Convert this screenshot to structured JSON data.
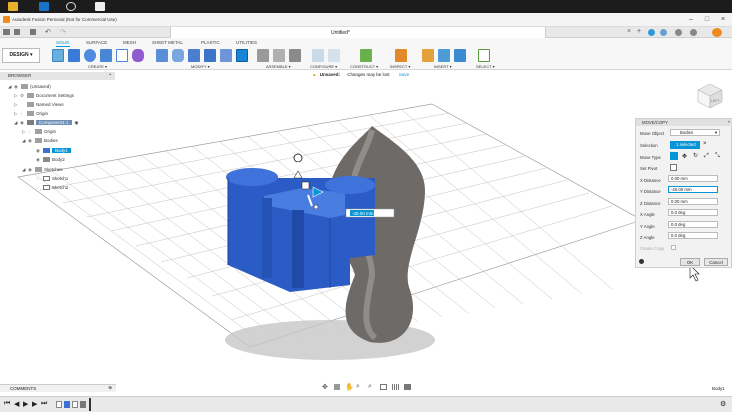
{
  "window": {
    "title": "Autodesk Fusion Personal (Not for Commercial Use)",
    "minimize": "–",
    "maximize": "□",
    "close": "×"
  },
  "document_tab": {
    "title": "Untitled*"
  },
  "ribbon": {
    "workspace": "DESIGN ▾",
    "tabs": [
      "SOLID",
      "SURFACE",
      "MESH",
      "SHEET METAL",
      "PLASTIC",
      "UTILITIES"
    ],
    "active_tab": "SOLID",
    "groups": [
      "CREATE ▾",
      "MODIFY ▾",
      "ASSEMBLE ▾",
      "CONFIGURE ▾",
      "CONSTRUCT ▾",
      "INSPECT ▾",
      "INSERT ▾",
      "SELECT ▾"
    ]
  },
  "unsaved_bar": {
    "label": "Unsaved:",
    "message": "Changes may be lost",
    "save": "Save"
  },
  "browser": {
    "title": "BROWSER",
    "items": [
      {
        "label": "(Unsaved)"
      },
      {
        "label": "Document Settings"
      },
      {
        "label": "Named Views"
      },
      {
        "label": "Origin"
      },
      {
        "label": "Component1:1"
      },
      {
        "label": "Origin"
      },
      {
        "label": "Bodies"
      },
      {
        "label": "Body1"
      },
      {
        "label": "Body2"
      },
      {
        "label": "Sketches"
      },
      {
        "label": "Sketch1"
      },
      {
        "label": "Sketch2"
      }
    ]
  },
  "viewport": {
    "distance_input": "-40.00 mm",
    "viewcube_face": "LEFT"
  },
  "move_panel": {
    "title": "MOVE/COPY",
    "move_object_label": "Move Object",
    "move_object_value": "Bodies",
    "selection_label": "Selection",
    "selection_value": "1 selected",
    "move_type_label": "Move Type",
    "set_pivot_label": "Set Pivot",
    "fields": [
      {
        "label": "X Distance",
        "value": "0.00 mm"
      },
      {
        "label": "Y Distance",
        "value": "-40.00 mm"
      },
      {
        "label": "Z Distance",
        "value": "0.00 mm"
      },
      {
        "label": "X Angle",
        "value": "0.0 deg"
      },
      {
        "label": "Y Angle",
        "value": "0.0 deg"
      },
      {
        "label": "Z Angle",
        "value": "0.0 deg"
      }
    ],
    "create_copy_label": "Create Copy",
    "ok": "OK",
    "cancel": "Cancel"
  },
  "comments": {
    "label": "COMMENTS"
  },
  "status": {
    "selection": "Body1"
  },
  "colors": {
    "accent": "#0696d7",
    "body_blue": "#2f5fc8",
    "grid": "#b8b8b8"
  }
}
